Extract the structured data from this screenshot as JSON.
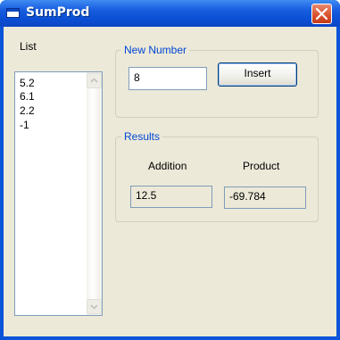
{
  "window": {
    "title": "SumProd"
  },
  "list": {
    "label": "List",
    "items": [
      "5.2",
      "6.1",
      "2.2",
      "-1"
    ]
  },
  "new_number": {
    "group_title": "New Number",
    "input_value": "8",
    "insert_label": "Insert"
  },
  "results": {
    "group_title": "Results",
    "addition_label": "Addition",
    "product_label": "Product",
    "addition_value": "12.5",
    "product_value": "-69.784"
  },
  "colors": {
    "titlebar": "#0b4fd4",
    "client_bg": "#ece9d8",
    "group_title": "#0046d5",
    "close_button": "#d9502c"
  },
  "icons": [
    "app-window-icon",
    "close-icon",
    "scroll-up-icon",
    "scroll-down-icon"
  ]
}
